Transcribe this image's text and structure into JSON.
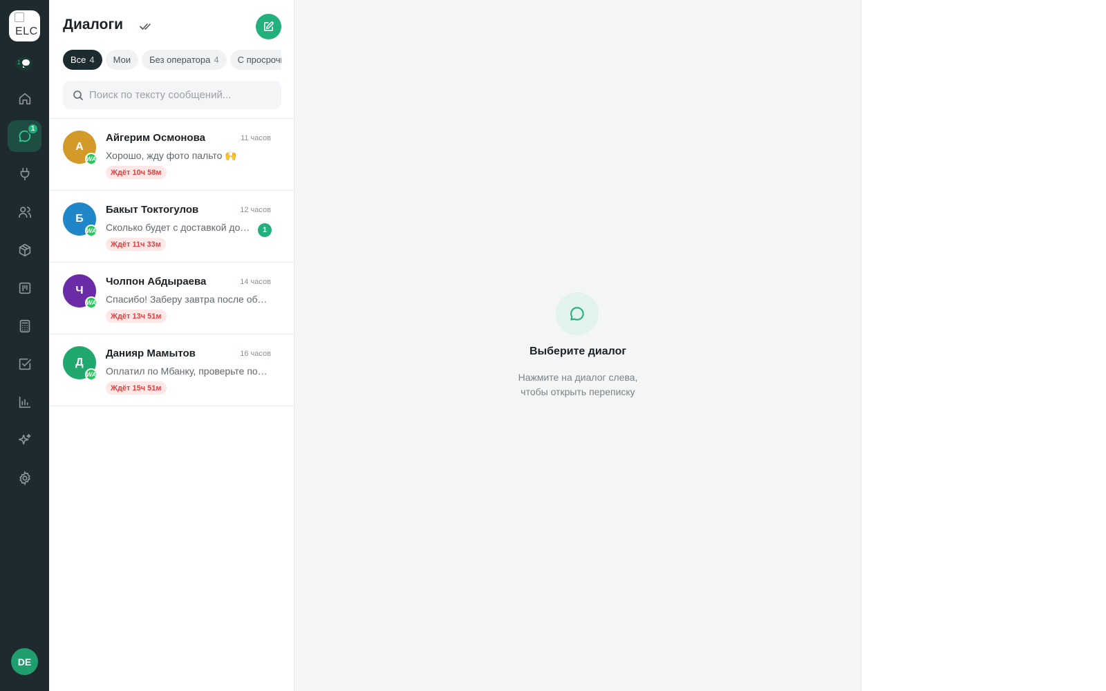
{
  "rail": {
    "logo_alt": "ELC",
    "mini_chat_count": "1",
    "nav": [
      {
        "name": "home",
        "icon": "home-icon"
      },
      {
        "name": "dialogs",
        "icon": "chat-icon",
        "badge": "1",
        "active": true
      },
      {
        "name": "integrations",
        "icon": "plug-icon"
      },
      {
        "name": "clients",
        "icon": "users-icon"
      },
      {
        "name": "products",
        "icon": "box-icon"
      },
      {
        "name": "board",
        "icon": "kanban-icon"
      },
      {
        "name": "calculator",
        "icon": "calculator-icon"
      },
      {
        "name": "tasks",
        "icon": "checkbox-icon"
      },
      {
        "name": "analytics",
        "icon": "bar-chart-icon"
      },
      {
        "name": "ai",
        "icon": "sparkles-icon"
      },
      {
        "name": "settings",
        "icon": "gear-icon"
      }
    ],
    "user_initials": "DE"
  },
  "panel": {
    "title": "Диалоги",
    "filters": [
      {
        "label": "Все",
        "count": "4",
        "active": true
      },
      {
        "label": "Мои",
        "count": ""
      },
      {
        "label": "Без оператора",
        "count": "4"
      },
      {
        "label": "С просрочкой",
        "count": ""
      }
    ],
    "search_placeholder": "Поиск по тексту сообщений..."
  },
  "dialogs": [
    {
      "initial": "А",
      "color": "#d39a2a",
      "name": "Айгерим Осмонова",
      "time": "11 часов",
      "preview": "Хорошо, жду фото пальто 🙌",
      "unread": "",
      "wait": "Ждёт 10ч 58м",
      "channel": "WA"
    },
    {
      "initial": "Б",
      "color": "#1f86c7",
      "name": "Бакыт Токтогулов",
      "time": "12 часов",
      "preview": "Сколько будет с доставкой до Оша?",
      "unread": "1",
      "wait": "Ждёт 11ч 33м",
      "channel": "WA"
    },
    {
      "initial": "Ч",
      "color": "#6b2aa6",
      "name": "Чолпон Абдыраева",
      "time": "14 часов",
      "preview": "Спасибо! Заберу завтра после обеда",
      "unread": "",
      "wait": "Ждёт 13ч 51м",
      "channel": "WA"
    },
    {
      "initial": "Д",
      "color": "#21a86f",
      "name": "Данияр Мамытов",
      "time": "16 часов",
      "preview": "Оплатил по Мбанку, проверьте пожалуйста",
      "unread": "",
      "wait": "Ждёт 15ч 51м",
      "channel": "WA"
    }
  ],
  "main": {
    "empty_title": "Выберите диалог",
    "empty_line1": "Нажмите на диалог слева,",
    "empty_line2": "чтобы открыть переписку"
  },
  "colors": {
    "accent": "#22b07d",
    "rail_bg": "#1f2a2e",
    "wait_bg": "#fde7e7",
    "wait_text": "#d94444"
  }
}
